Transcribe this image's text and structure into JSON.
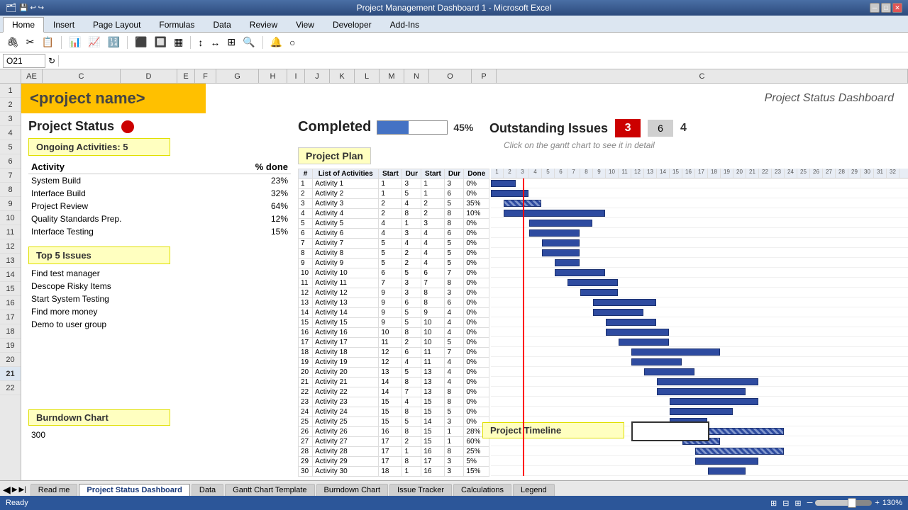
{
  "window": {
    "title": "Project Management Dashboard 1 - Microsoft Excel"
  },
  "ribbon": {
    "tabs": [
      "Home",
      "Insert",
      "Page Layout",
      "Formulas",
      "Data",
      "Review",
      "View",
      "Developer",
      "Add-Ins"
    ],
    "active_tab": "Home"
  },
  "formula_bar": {
    "cell_ref": "O21",
    "value": ""
  },
  "columns": [
    "AE",
    "C",
    "D",
    "E",
    "F",
    "G",
    "H",
    "I",
    "J",
    "K",
    "L",
    "M",
    "N",
    "O",
    "P",
    "C"
  ],
  "rows": [
    1,
    2,
    3,
    4,
    5,
    6,
    7,
    8,
    9,
    10,
    11,
    12,
    13,
    14,
    15,
    16,
    17,
    18,
    19,
    20,
    21,
    22
  ],
  "dashboard": {
    "project_name_placeholder": "<project name>",
    "title": "Project Status Dashboard",
    "project_status": {
      "label": "Project Status",
      "status_color": "red",
      "ongoing_activities_label": "Ongoing Activities: 5",
      "activity_header": "Activity",
      "pct_done_header": "% done",
      "activities": [
        {
          "name": "System Build",
          "pct": "23%"
        },
        {
          "name": "Interface Build",
          "pct": "32%"
        },
        {
          "name": "Project Review",
          "pct": "64%"
        },
        {
          "name": "Quality Standards Prep.",
          "pct": "12%"
        },
        {
          "name": "Interface Testing",
          "pct": "15%"
        }
      ],
      "top5_issues_label": "Top 5 Issues",
      "issues": [
        "Find test manager",
        "Descope Risky Items",
        "Start System Testing",
        "Find more money",
        "Demo to user group"
      ]
    },
    "completed": {
      "label": "Completed",
      "progress_pct": 45,
      "progress_display": "45%"
    },
    "outstanding_issues": {
      "label": "Outstanding Issues",
      "value1": "3",
      "value2": "6",
      "value3": "4"
    },
    "gantt_hint": "Click on the gantt chart to see it in detail",
    "project_plan": {
      "label": "Project Plan",
      "col_headers": [
        "#",
        "List of Activities",
        "Start",
        "Dur",
        "Start",
        "Dur",
        "Done"
      ],
      "gantt_col_nums": [
        1,
        2,
        3,
        4,
        5,
        6,
        7,
        8,
        9,
        10,
        11,
        12,
        13,
        14,
        15,
        16,
        17,
        18,
        19,
        20,
        21,
        22,
        23,
        24,
        25,
        26,
        27,
        28,
        29,
        30,
        31,
        32
      ],
      "activities": [
        {
          "num": 1,
          "name": "Activity 1",
          "s1": 1,
          "d1": 3,
          "s2": 1,
          "d2": 3,
          "done": "0%"
        },
        {
          "num": 2,
          "name": "Activity 2",
          "s1": 1,
          "d1": 5,
          "s2": 1,
          "d2": 6,
          "done": "0%"
        },
        {
          "num": 3,
          "name": "Activity 3",
          "s1": 2,
          "d1": 4,
          "s2": 2,
          "d2": 5,
          "done": "35%"
        },
        {
          "num": 4,
          "name": "Activity 4",
          "s1": 2,
          "d1": 8,
          "s2": 2,
          "d2": 8,
          "done": "10%"
        },
        {
          "num": 5,
          "name": "Activity 5",
          "s1": 4,
          "d1": 1,
          "s2": 3,
          "d2": 8,
          "done": "0%"
        },
        {
          "num": 6,
          "name": "Activity 6",
          "s1": 4,
          "d1": 3,
          "s2": 4,
          "d2": 6,
          "done": "0%"
        },
        {
          "num": 7,
          "name": "Activity 7",
          "s1": 5,
          "d1": 4,
          "s2": 4,
          "d2": 5,
          "done": "0%"
        },
        {
          "num": 8,
          "name": "Activity 8",
          "s1": 5,
          "d1": 2,
          "s2": 4,
          "d2": 5,
          "done": "0%"
        },
        {
          "num": 9,
          "name": "Activity 9",
          "s1": 5,
          "d1": 2,
          "s2": 4,
          "d2": 5,
          "done": "0%"
        },
        {
          "num": 10,
          "name": "Activity 10",
          "s1": 6,
          "d1": 5,
          "s2": 6,
          "d2": 7,
          "done": "0%"
        },
        {
          "num": 11,
          "name": "Activity 11",
          "s1": 7,
          "d1": 3,
          "s2": 7,
          "d2": 8,
          "done": "0%"
        },
        {
          "num": 12,
          "name": "Activity 12",
          "s1": 9,
          "d1": 3,
          "s2": 8,
          "d2": 3,
          "done": "0%"
        },
        {
          "num": 13,
          "name": "Activity 13",
          "s1": 9,
          "d1": 6,
          "s2": 8,
          "d2": 6,
          "done": "0%"
        },
        {
          "num": 14,
          "name": "Activity 14",
          "s1": 9,
          "d1": 5,
          "s2": 9,
          "d2": 4,
          "done": "0%"
        },
        {
          "num": 15,
          "name": "Activity 15",
          "s1": 9,
          "d1": 5,
          "s2": 10,
          "d2": 4,
          "done": "0%"
        },
        {
          "num": 16,
          "name": "Activity 16",
          "s1": 10,
          "d1": 8,
          "s2": 10,
          "d2": 4,
          "done": "0%"
        },
        {
          "num": 17,
          "name": "Activity 17",
          "s1": 11,
          "d1": 2,
          "s2": 10,
          "d2": 5,
          "done": "0%"
        },
        {
          "num": 18,
          "name": "Activity 18",
          "s1": 12,
          "d1": 6,
          "s2": 11,
          "d2": 7,
          "done": "0%"
        },
        {
          "num": 19,
          "name": "Activity 19",
          "s1": 12,
          "d1": 4,
          "s2": 11,
          "d2": 4,
          "done": "0%"
        },
        {
          "num": 20,
          "name": "Activity 20",
          "s1": 13,
          "d1": 5,
          "s2": 13,
          "d2": 4,
          "done": "0%"
        },
        {
          "num": 21,
          "name": "Activity 21",
          "s1": 14,
          "d1": 8,
          "s2": 13,
          "d2": 4,
          "done": "0%"
        },
        {
          "num": 22,
          "name": "Activity 22",
          "s1": 14,
          "d1": 7,
          "s2": 13,
          "d2": 8,
          "done": "0%"
        },
        {
          "num": 23,
          "name": "Activity 23",
          "s1": 15,
          "d1": 4,
          "s2": 15,
          "d2": 8,
          "done": "0%"
        },
        {
          "num": 24,
          "name": "Activity 24",
          "s1": 15,
          "d1": 8,
          "s2": 15,
          "d2": 5,
          "done": "0%"
        },
        {
          "num": 25,
          "name": "Activity 25",
          "s1": 15,
          "d1": 5,
          "s2": 14,
          "d2": 3,
          "done": "0%"
        },
        {
          "num": 26,
          "name": "Activity 26",
          "s1": 16,
          "d1": 8,
          "s2": 15,
          "d2": 1,
          "done": "28%"
        },
        {
          "num": 27,
          "name": "Activity 27",
          "s1": 17,
          "d1": 2,
          "s2": 15,
          "d2": 1,
          "done": "60%"
        },
        {
          "num": 28,
          "name": "Activity 28",
          "s1": 17,
          "d1": 1,
          "s2": 16,
          "d2": 8,
          "done": "25%"
        },
        {
          "num": 29,
          "name": "Activity 29",
          "s1": 17,
          "d1": 8,
          "s2": 17,
          "d2": 3,
          "done": "5%"
        },
        {
          "num": 30,
          "name": "Activity 30",
          "s1": 18,
          "d1": 1,
          "s2": 16,
          "d2": 3,
          "done": "15%"
        }
      ],
      "gantt_bars": [
        {
          "row": 1,
          "start": 0,
          "width": 2,
          "striped": false
        },
        {
          "row": 2,
          "start": 0,
          "width": 3,
          "striped": false
        },
        {
          "row": 3,
          "start": 1,
          "width": 3,
          "striped": true
        },
        {
          "row": 4,
          "start": 1,
          "width": 8,
          "striped": false
        },
        {
          "row": 5,
          "start": 3,
          "width": 5,
          "striped": false
        },
        {
          "row": 6,
          "start": 3,
          "width": 4,
          "striped": false
        },
        {
          "row": 7,
          "start": 4,
          "width": 3,
          "striped": false
        },
        {
          "row": 8,
          "start": 4,
          "width": 3,
          "striped": false
        },
        {
          "row": 9,
          "start": 5,
          "width": 2,
          "striped": false
        },
        {
          "row": 10,
          "start": 5,
          "width": 4,
          "striped": false
        },
        {
          "row": 11,
          "start": 6,
          "width": 4,
          "striped": false
        },
        {
          "row": 12,
          "start": 7,
          "width": 3,
          "striped": false
        },
        {
          "row": 13,
          "start": 8,
          "width": 5,
          "striped": false
        },
        {
          "row": 14,
          "start": 8,
          "width": 4,
          "striped": false
        },
        {
          "row": 15,
          "start": 9,
          "width": 4,
          "striped": false
        },
        {
          "row": 16,
          "start": 9,
          "width": 5,
          "striped": false
        },
        {
          "row": 17,
          "start": 10,
          "width": 4,
          "striped": false
        },
        {
          "row": 18,
          "start": 11,
          "width": 7,
          "striped": false
        },
        {
          "row": 19,
          "start": 11,
          "width": 4,
          "striped": false
        },
        {
          "row": 20,
          "start": 12,
          "width": 4,
          "striped": false
        },
        {
          "row": 21,
          "start": 13,
          "width": 8,
          "striped": false
        },
        {
          "row": 22,
          "start": 13,
          "width": 7,
          "striped": false
        },
        {
          "row": 23,
          "start": 14,
          "width": 7,
          "striped": false
        },
        {
          "row": 24,
          "start": 14,
          "width": 5,
          "striped": false
        },
        {
          "row": 25,
          "start": 14,
          "width": 3,
          "striped": false
        },
        {
          "row": 26,
          "start": 15,
          "width": 8,
          "striped": true
        },
        {
          "row": 27,
          "start": 15,
          "width": 3,
          "striped": true
        },
        {
          "row": 28,
          "start": 16,
          "width": 7,
          "striped": true
        },
        {
          "row": 29,
          "start": 16,
          "width": 5,
          "striped": false
        },
        {
          "row": 30,
          "start": 17,
          "width": 3,
          "striped": false
        }
      ]
    },
    "burndown": {
      "label": "Burndown Chart",
      "value": "300"
    },
    "timeline": {
      "label": "Project Timeline"
    }
  },
  "sheet_tabs": [
    {
      "name": "Read me",
      "active": false
    },
    {
      "name": "Project Status Dashboard",
      "active": true
    },
    {
      "name": "Data",
      "active": false
    },
    {
      "name": "Gantt Chart Template",
      "active": false
    },
    {
      "name": "Burndown Chart",
      "active": false
    },
    {
      "name": "Issue Tracker",
      "active": false
    },
    {
      "name": "Calculations",
      "active": false
    },
    {
      "name": "Legend",
      "active": false
    }
  ],
  "status_bar": {
    "left": "Ready",
    "zoom": "130%"
  }
}
